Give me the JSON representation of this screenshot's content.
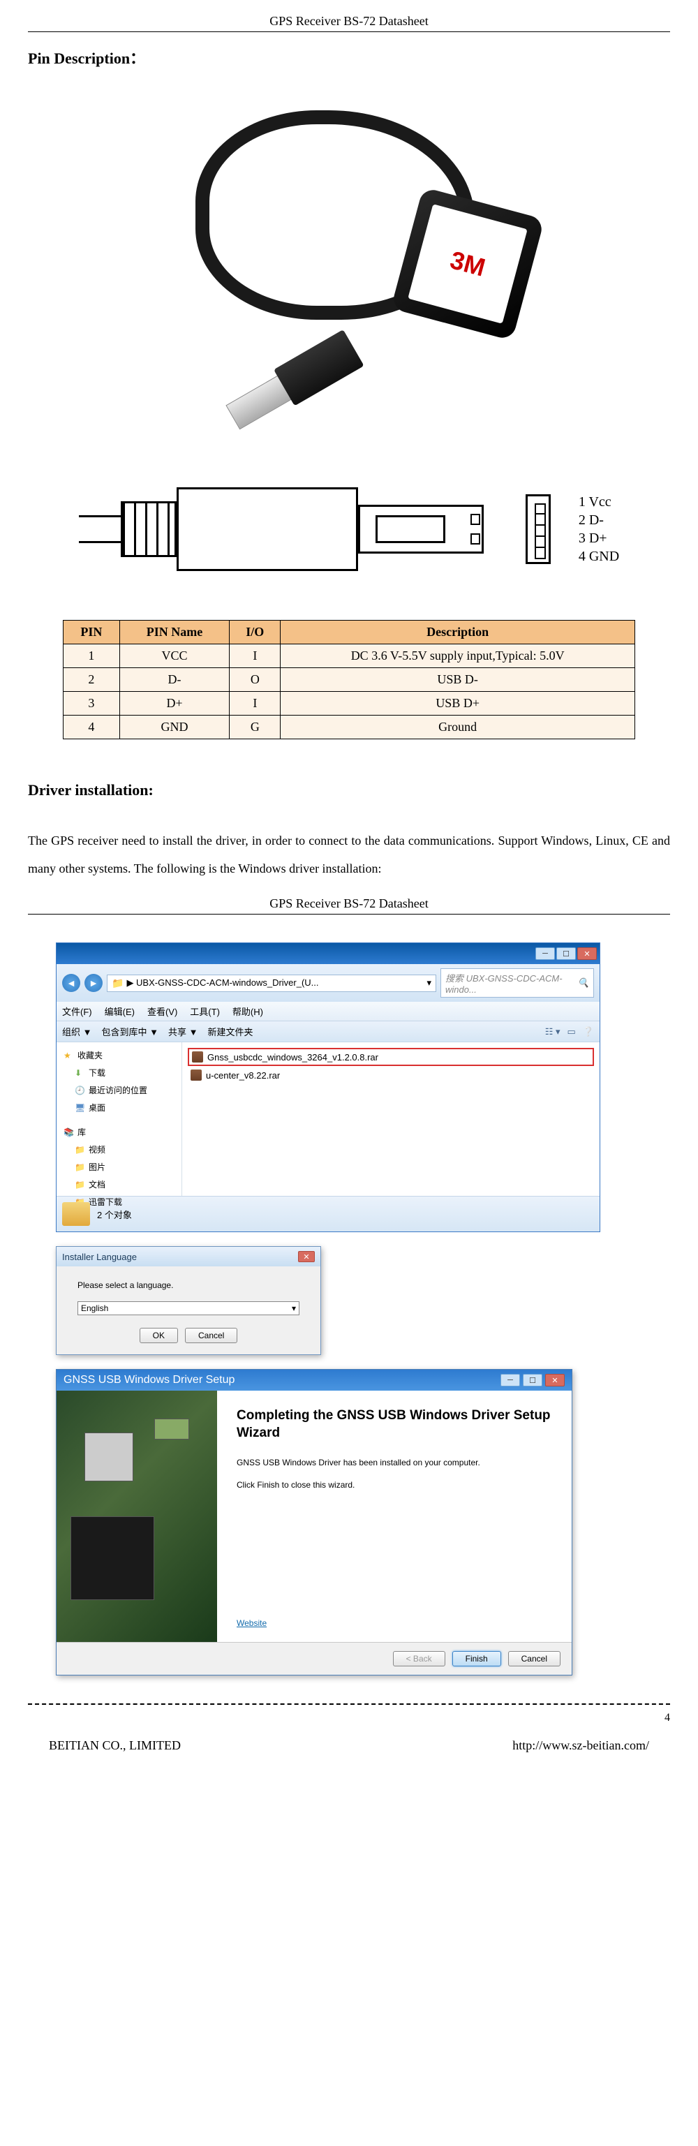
{
  "doc": {
    "header": "GPS Receiver BS-72 Datasheet",
    "section_pin": "Pin Description：",
    "pin_legend": {
      "l1": "1 Vcc",
      "l2": "2 D-",
      "l3": "3 D+",
      "l4": "4 GND"
    },
    "pin_table": {
      "headers": {
        "pin": "PIN",
        "name": "PIN Name",
        "io": "I/O",
        "desc": "Description"
      },
      "rows": [
        {
          "pin": "1",
          "name": "VCC",
          "io": "I",
          "desc": "DC 3.6 V-5.5V supply input,Typical: 5.0V"
        },
        {
          "pin": "2",
          "name": "D-",
          "io": "O",
          "desc": "USB D-"
        },
        {
          "pin": "3",
          "name": "D+",
          "io": "I",
          "desc": "USB D+"
        },
        {
          "pin": "4",
          "name": "GND",
          "io": "G",
          "desc": "Ground"
        }
      ]
    },
    "section_driver": "Driver installation:",
    "driver_text": "The GPS receiver need to install the driver, in order to connect to the data communications. Support Windows, Linux, CE and many other systems. The following is the Windows driver installation:",
    "header2": "GPS Receiver BS-72 Datasheet",
    "footer": {
      "left": "BEITIAN CO., LIMITED",
      "right": "http://www.sz-beitian.com/",
      "page": "4"
    },
    "product_sticker": "3M"
  },
  "explorer": {
    "path": "▶ UBX-GNSS-CDC-ACM-windows_Driver_(U...",
    "search_placeholder": "搜索 UBX-GNSS-CDC-ACM-windo...",
    "menu": {
      "file": "文件(F)",
      "edit": "编辑(E)",
      "view": "查看(V)",
      "tools": "工具(T)",
      "help": "帮助(H)"
    },
    "toolbar": {
      "organize": "组织 ▼",
      "include": "包含到库中 ▼",
      "share": "共享 ▼",
      "newfolder": "新建文件夹"
    },
    "nav": {
      "favorites": "收藏夹",
      "downloads": "下载",
      "recent": "最近访问的位置",
      "desktop": "桌面",
      "libraries": "库",
      "videos": "视频",
      "pictures": "图片",
      "documents": "文档",
      "xunlei": "迅雷下载"
    },
    "files": {
      "highlighted": "Gnss_usbcdc_windows_3264_v1.2.0.8.rar",
      "other": "u-center_v8.22.rar"
    },
    "status": "2 个对象"
  },
  "lang_dialog": {
    "title": "Installer Language",
    "prompt": "Please select a language.",
    "selected": "English",
    "ok": "OK",
    "cancel": "Cancel"
  },
  "wizard": {
    "title": "GNSS USB Windows Driver Setup",
    "heading": "Completing the GNSS USB Windows Driver Setup Wizard",
    "line1": "GNSS USB Windows Driver has been installed on your computer.",
    "line2": "Click Finish to close this wizard.",
    "website": "Website",
    "back": "< Back",
    "finish": "Finish",
    "cancel": "Cancel"
  }
}
